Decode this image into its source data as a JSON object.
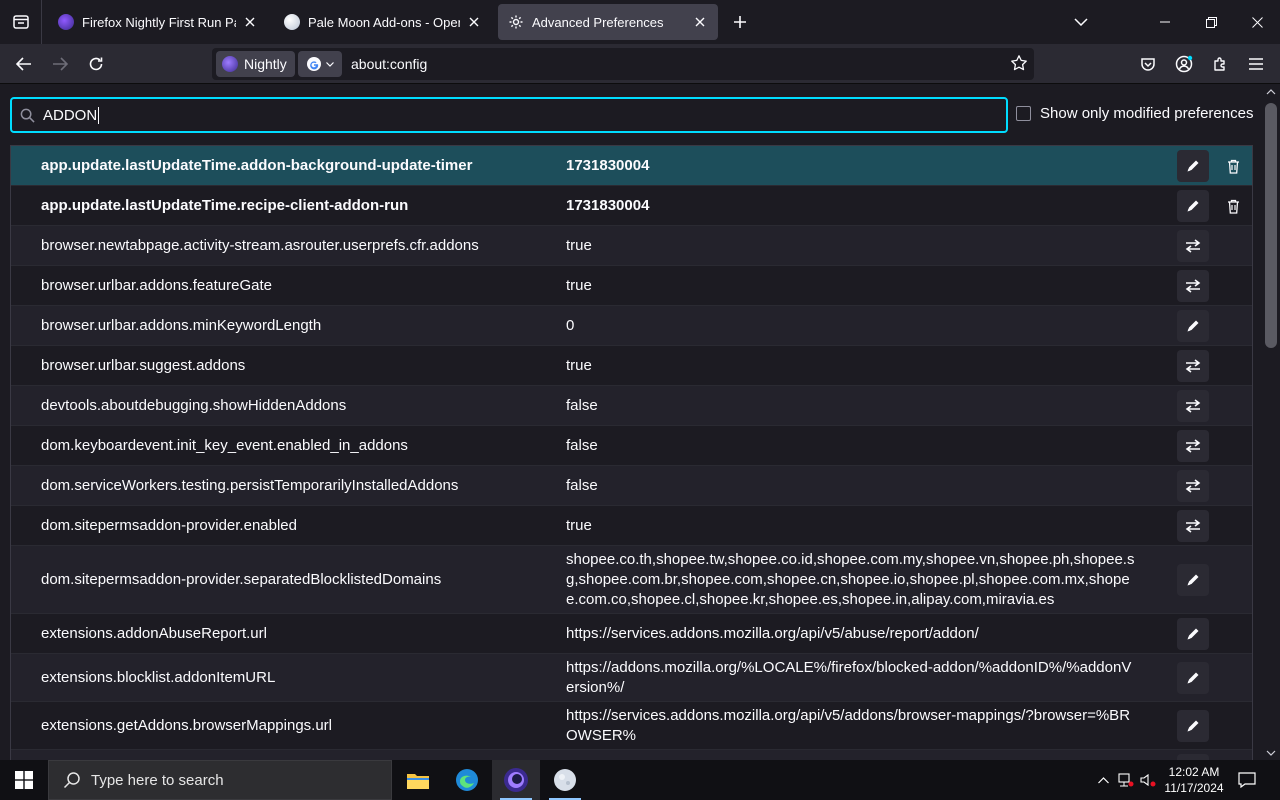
{
  "tabs": [
    {
      "title": "Firefox Nightly First Run Page",
      "active": false
    },
    {
      "title": "Pale Moon Add-ons - OpenDo",
      "active": false
    },
    {
      "title": "Advanced Preferences",
      "active": true
    }
  ],
  "urlbar": {
    "identity_label": "Nightly",
    "url": "about:config"
  },
  "search": {
    "value": "ADDON",
    "modified_label": "Show only modified preferences"
  },
  "prefs": [
    {
      "name": "app.update.lastUpdateTime.addon-background-update-timer",
      "value": "1731830004",
      "action": "edit",
      "modified": true
    },
    {
      "name": "app.update.lastUpdateTime.recipe-client-addon-run",
      "value": "1731830004",
      "action": "edit",
      "modified": true
    },
    {
      "name": "browser.newtabpage.activity-stream.asrouter.userprefs.cfr.addons",
      "value": "true",
      "action": "toggle",
      "modified": false
    },
    {
      "name": "browser.urlbar.addons.featureGate",
      "value": "true",
      "action": "toggle",
      "modified": false
    },
    {
      "name": "browser.urlbar.addons.minKeywordLength",
      "value": "0",
      "action": "edit",
      "modified": false
    },
    {
      "name": "browser.urlbar.suggest.addons",
      "value": "true",
      "action": "toggle",
      "modified": false
    },
    {
      "name": "devtools.aboutdebugging.showHiddenAddons",
      "value": "false",
      "action": "toggle",
      "modified": false
    },
    {
      "name": "dom.keyboardevent.init_key_event.enabled_in_addons",
      "value": "false",
      "action": "toggle",
      "modified": false
    },
    {
      "name": "dom.serviceWorkers.testing.persistTemporarilyInstalledAddons",
      "value": "false",
      "action": "toggle",
      "modified": false
    },
    {
      "name": "dom.sitepermsaddon-provider.enabled",
      "value": "true",
      "action": "toggle",
      "modified": false
    },
    {
      "name": "dom.sitepermsaddon-provider.separatedBlocklistedDomains",
      "value": "shopee.co.th,shopee.tw,shopee.co.id,shopee.com.my,shopee.vn,shopee.ph,shopee.sg,shopee.com.br,shopee.com,shopee.cn,shopee.io,shopee.pl,shopee.com.mx,shopee.com.co,shopee.cl,shopee.kr,shopee.es,shopee.in,alipay.com,miravia.es",
      "action": "edit",
      "modified": false
    },
    {
      "name": "extensions.addonAbuseReport.url",
      "value": "https://services.addons.mozilla.org/api/v5/abuse/report/addon/",
      "action": "edit",
      "modified": false
    },
    {
      "name": "extensions.blocklist.addonItemURL",
      "value": "https://addons.mozilla.org/%LOCALE%/firefox/blocked-addon/%addonID%/%addonVersion%/",
      "action": "edit",
      "modified": false
    },
    {
      "name": "extensions.getAddons.browserMappings.url",
      "value": "https://services.addons.mozilla.org/api/v5/addons/browser-mappings/?browser=%BROWSER%",
      "action": "edit",
      "modified": false
    },
    {
      "name": "",
      "value": "",
      "action": "edit",
      "modified": false
    }
  ],
  "taskbar": {
    "search_placeholder": "Type here to search",
    "time": "12:02 AM",
    "date": "11/17/2024"
  },
  "colors": {
    "accent": "#00ddff",
    "hover_row": "#1d4e5b",
    "background": "#1c1b22"
  }
}
